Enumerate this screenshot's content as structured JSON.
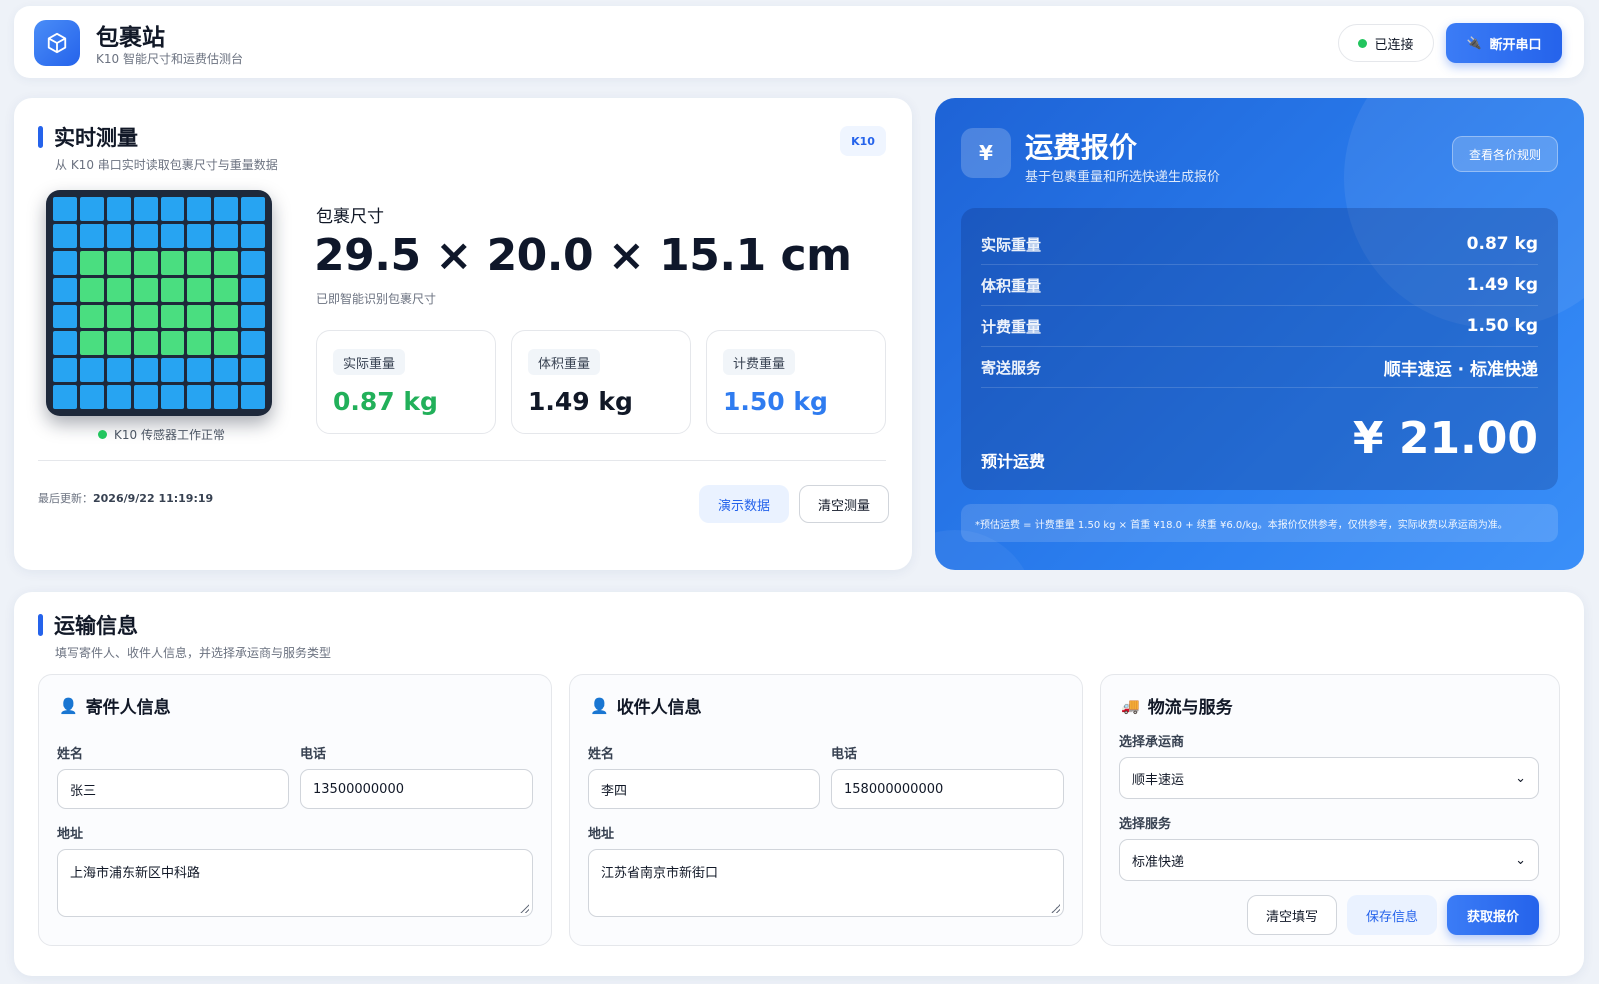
{
  "header": {
    "title": "包裹站",
    "subtitle": "K10 智能尺寸和运费估测台",
    "status": "已连接",
    "disconnect_label": "断开串口"
  },
  "measure": {
    "title": "实时测量",
    "subtitle": "从 K10 串口实时读取包裹尺寸与重量数据",
    "tag": "K10",
    "sensor_status": "K10 传感器工作正常",
    "dimension_label": "包裹尺寸",
    "dimension_value": "29.5 × 20.0 × 15.1 cm",
    "dimension_note": "已即智能识别包裹尺寸",
    "weights": [
      {
        "label": "实际重量",
        "value": "0.87 kg",
        "color": "#22b05a"
      },
      {
        "label": "体积重量",
        "value": "1.49 kg",
        "color": "#111827"
      },
      {
        "label": "计费重量",
        "value": "1.50 kg",
        "color": "#2f7cf0"
      }
    ],
    "last_update_label": "最后更新：",
    "last_update_value": "2026/9/22 11:19:19",
    "demo_label": "演示数据",
    "clear_label": "清空测量",
    "matrix_on_rows": [
      2,
      3,
      4,
      5
    ],
    "matrix_on_cols": [
      1,
      2,
      3,
      4,
      5,
      6
    ]
  },
  "quote": {
    "title": "运费报价",
    "subtitle": "基于包裹重量和所选快递生成报价",
    "rules_label": "查看各价规则",
    "rows": [
      {
        "key": "实际重量",
        "value": "0.87 kg"
      },
      {
        "key": "体积重量",
        "value": "1.49 kg"
      },
      {
        "key": "计费重量",
        "value": "1.50 kg"
      },
      {
        "key": "寄送服务",
        "value": "顺丰速运 · 标准快递"
      }
    ],
    "estimate_label": "预计运费",
    "estimate_value": "¥ 21.00",
    "note": "*预估运费 = 计费重量 1.50 kg × 首重 ¥18.0 + 续重 ¥6.0/kg。本报价仅供参考，仅供参考，实际收费以承运商为准。"
  },
  "shipping": {
    "title": "运输信息",
    "subtitle": "填写寄件人、收件人信息，并选择承运商与服务类型",
    "sender": {
      "title": "寄件人信息",
      "name_label": "姓名",
      "phone_label": "电话",
      "address_label": "地址",
      "name": "张三",
      "phone": "13500000000",
      "address": "上海市浦东新区中科路"
    },
    "receiver": {
      "title": "收件人信息",
      "name_label": "姓名",
      "phone_label": "电话",
      "address_label": "地址",
      "name": "李四",
      "phone": "158000000000",
      "address": "江苏省南京市新街口"
    },
    "logistics": {
      "title": "物流与服务",
      "carrier_label": "选择承运商",
      "carrier_value": "顺丰速运",
      "service_label": "选择服务",
      "service_value": "标准快递",
      "clear_label": "清空填写",
      "save_label": "保存信息",
      "quote_label": "获取报价"
    }
  }
}
